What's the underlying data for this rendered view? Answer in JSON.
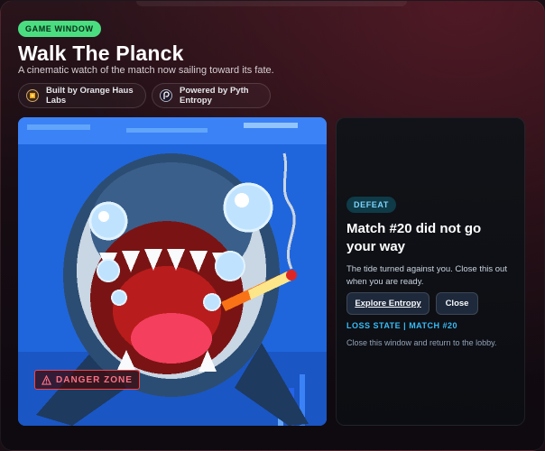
{
  "window": {
    "badge": "GAME WINDOW",
    "title": "Walk The Planck",
    "subtitle": "A cinematic watch of the match now sailing toward its fate."
  },
  "credits": [
    {
      "label": "Built by Orange Haus Labs",
      "icon": "orange-haus-logo-icon"
    },
    {
      "label": "Powered by Pyth Entropy",
      "icon": "pyth-logo-icon"
    }
  ],
  "art": {
    "description_icon": "shark-pixel-art",
    "danger_label": "DANGER ZONE",
    "danger_icon": "warning-triangle-icon"
  },
  "result": {
    "badge": "DEFEAT",
    "title": "Match #20 did not go your way",
    "body": "The tide turned against you. Close this out when you are ready.",
    "primary_button": "Explore Entropy",
    "secondary_button": "Close",
    "state_label": "LOSS STATE | MATCH #20",
    "hint": "Close this window and return to the lobby."
  },
  "colors": {
    "accent_green": "#4ade80",
    "accent_cyan": "#38bdf8",
    "danger_red": "#ef4444",
    "art_blue": "#1e63d8"
  }
}
